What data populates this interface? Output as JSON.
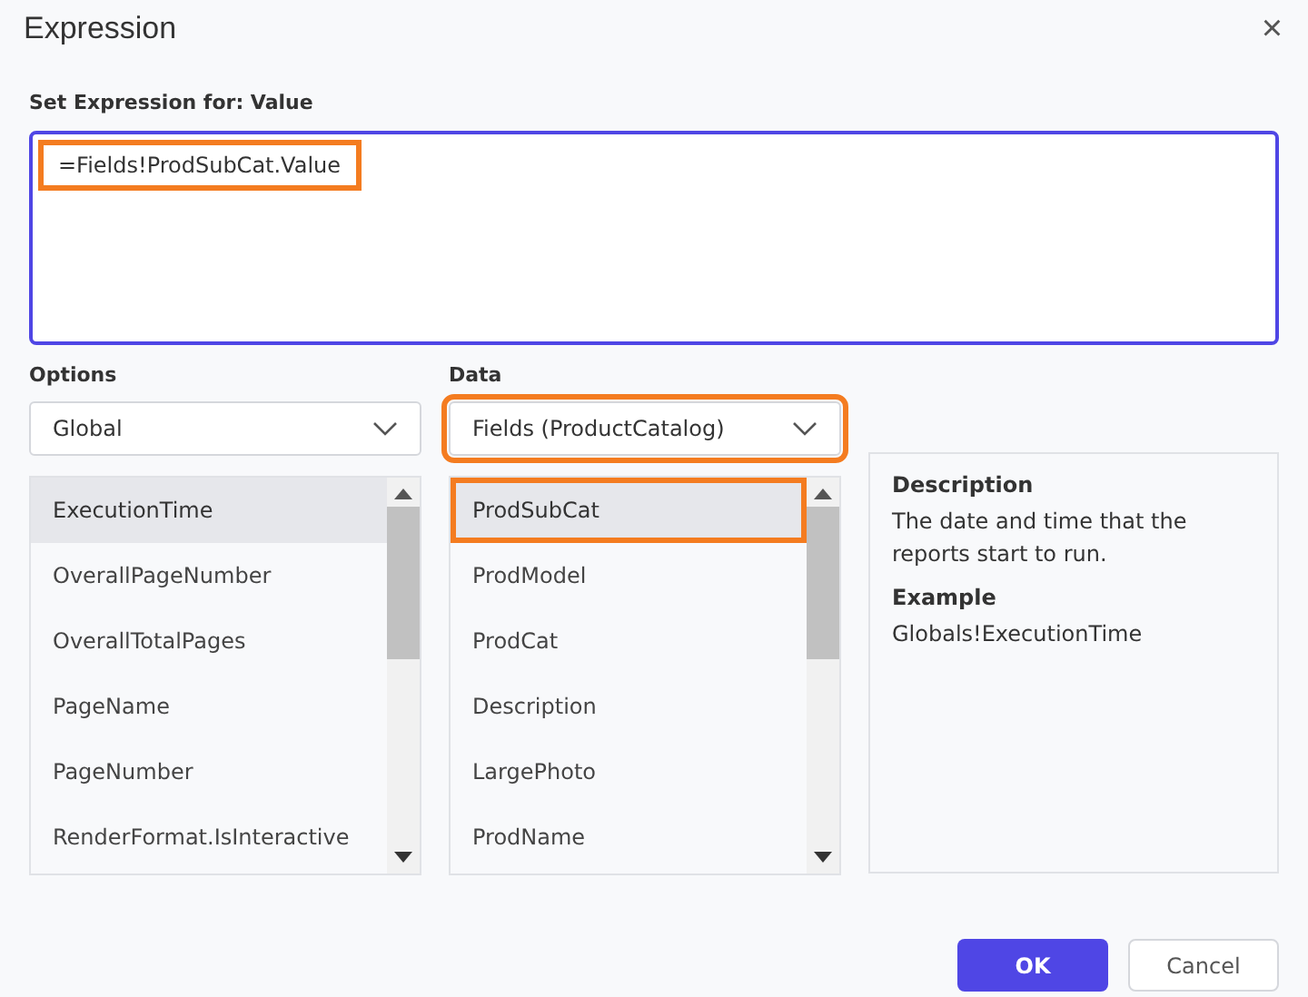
{
  "window": {
    "title": "Expression",
    "close": "×"
  },
  "expression": {
    "label": "Set Expression for: Value",
    "value": "=Fields!ProdSubCat.Value",
    "highlighted": true
  },
  "options": {
    "label": "Options",
    "dropdown": {
      "value": "Global",
      "highlighted": false
    },
    "items": [
      {
        "label": "ExecutionTime",
        "selected": true,
        "highlighted": false
      },
      {
        "label": "OverallPageNumber",
        "selected": false,
        "highlighted": false
      },
      {
        "label": "OverallTotalPages",
        "selected": false,
        "highlighted": false
      },
      {
        "label": "PageName",
        "selected": false,
        "highlighted": false
      },
      {
        "label": "PageNumber",
        "selected": false,
        "highlighted": false
      },
      {
        "label": "RenderFormat.IsInteractive",
        "selected": false,
        "highlighted": false
      }
    ]
  },
  "data": {
    "label": "Data",
    "dropdown": {
      "value": "Fields (ProductCatalog)",
      "highlighted": true
    },
    "items": [
      {
        "label": "ProdSubCat",
        "selected": true,
        "highlighted": true
      },
      {
        "label": "ProdModel",
        "selected": false,
        "highlighted": false
      },
      {
        "label": "ProdCat",
        "selected": false,
        "highlighted": false
      },
      {
        "label": "Description",
        "selected": false,
        "highlighted": false
      },
      {
        "label": "LargePhoto",
        "selected": false,
        "highlighted": false
      },
      {
        "label": "ProdName",
        "selected": false,
        "highlighted": false
      }
    ]
  },
  "info": {
    "description_heading": "Description",
    "description": "The date and time that the reports start to run.",
    "example_heading": "Example",
    "example": "Globals!ExecutionTime"
  },
  "buttons": [
    {
      "label": "OK",
      "kind": "primary"
    },
    {
      "label": "Cancel",
      "kind": "secondary"
    }
  ]
}
